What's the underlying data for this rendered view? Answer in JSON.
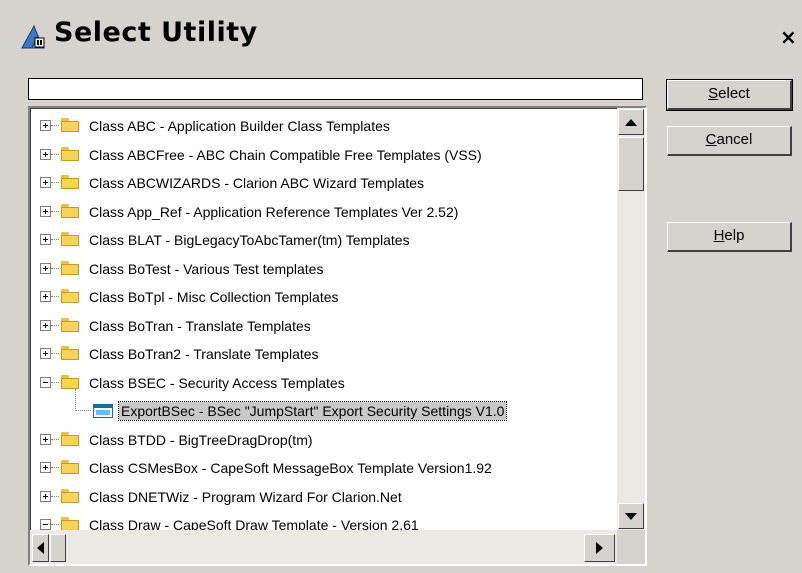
{
  "window": {
    "title": "Select Utility",
    "close_label": "×"
  },
  "filter": {
    "value": "",
    "placeholder": ""
  },
  "buttons": {
    "select_mnemonic": "S",
    "select_rest": "elect",
    "cancel_mnemonic": "C",
    "cancel_rest": "ancel",
    "help_mnemonic": "H",
    "help_rest": "elp"
  },
  "tree": {
    "items": [
      {
        "label": "Class ABC - Application Builder Class Templates",
        "expanded": false
      },
      {
        "label": "Class ABCFree - ABC Chain Compatible Free Templates (VSS)",
        "expanded": false
      },
      {
        "label": "Class ABCWIZARDS - Clarion ABC Wizard Templates",
        "expanded": false
      },
      {
        "label": "Class App_Ref - Application Reference Templates Ver 2.52)",
        "expanded": false
      },
      {
        "label": "Class BLAT - BigLegacyToAbcTamer(tm) Templates",
        "expanded": false
      },
      {
        "label": "Class BoTest - Various Test templates",
        "expanded": false
      },
      {
        "label": "Class BoTpl - Misc Collection Templates",
        "expanded": false
      },
      {
        "label": "Class BoTran -  Translate Templates",
        "expanded": false
      },
      {
        "label": "Class BoTran2 -  Translate Templates",
        "expanded": false
      },
      {
        "label": "Class BSEC - Security Access Templates",
        "expanded": true
      },
      {
        "label": "ExportBSec - BSec \"JumpStart\" Export Security Settings V1.0",
        "child": true,
        "selected": true
      },
      {
        "label": "Class BTDD - BigTreeDragDrop(tm)",
        "expanded": false
      },
      {
        "label": "Class CSMesBox - CapeSoft MessageBox Template Version1.92",
        "expanded": false
      },
      {
        "label": "Class DNETWiz - Program Wizard For Clarion.Net",
        "expanded": false
      },
      {
        "label": "Class Draw - CapeSoft Draw Template - Version 2.61",
        "expanded": true
      }
    ]
  },
  "colors": {
    "dialog_bg": "#d6d3ce",
    "selection_bg": "#c9c9c9",
    "folder": "#f7d35a",
    "template_icon": "#1b6aa0"
  },
  "icons": {
    "title": "wizard-hat-icon",
    "folder": "folder-icon",
    "template": "template-window-icon"
  }
}
